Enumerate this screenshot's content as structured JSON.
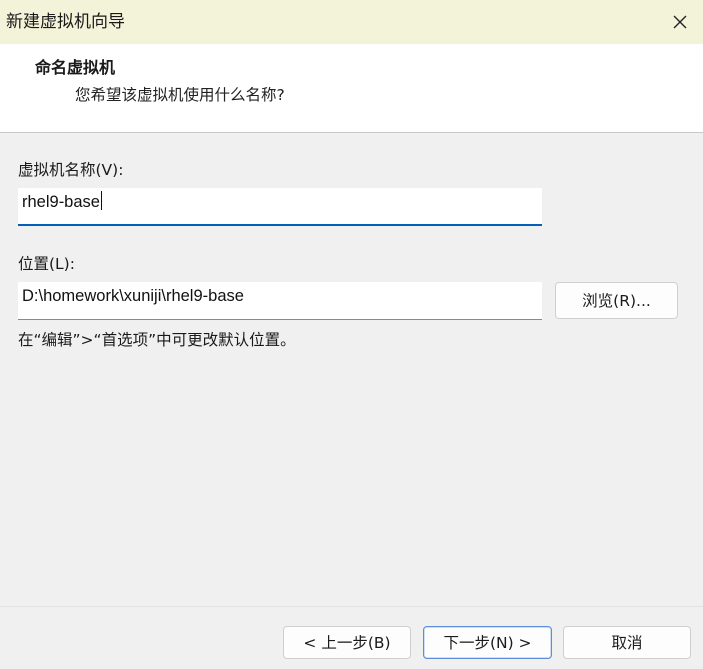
{
  "window": {
    "title": "新建虚拟机向导",
    "close_icon": "close-icon"
  },
  "header": {
    "title": "命名虚拟机",
    "subtitle": "您希望该虚拟机使用什么名称?"
  },
  "form": {
    "name_label": "虚拟机名称(V):",
    "name_value": "rhel9-base",
    "location_label": "位置(L):",
    "location_value": "D:\\homework\\xuniji\\rhel9-base",
    "browse_label": "浏览(R)...",
    "hint": "在“编辑”>“首选项”中可更改默认位置。"
  },
  "footer": {
    "back_label": "< 上一步(B)",
    "next_label": "下一步(N) >",
    "cancel_label": "取消"
  },
  "colors": {
    "titlebar": "#f3f3d9",
    "focus_accent": "#005fb8",
    "primary_button_border": "#5a8fd6"
  }
}
